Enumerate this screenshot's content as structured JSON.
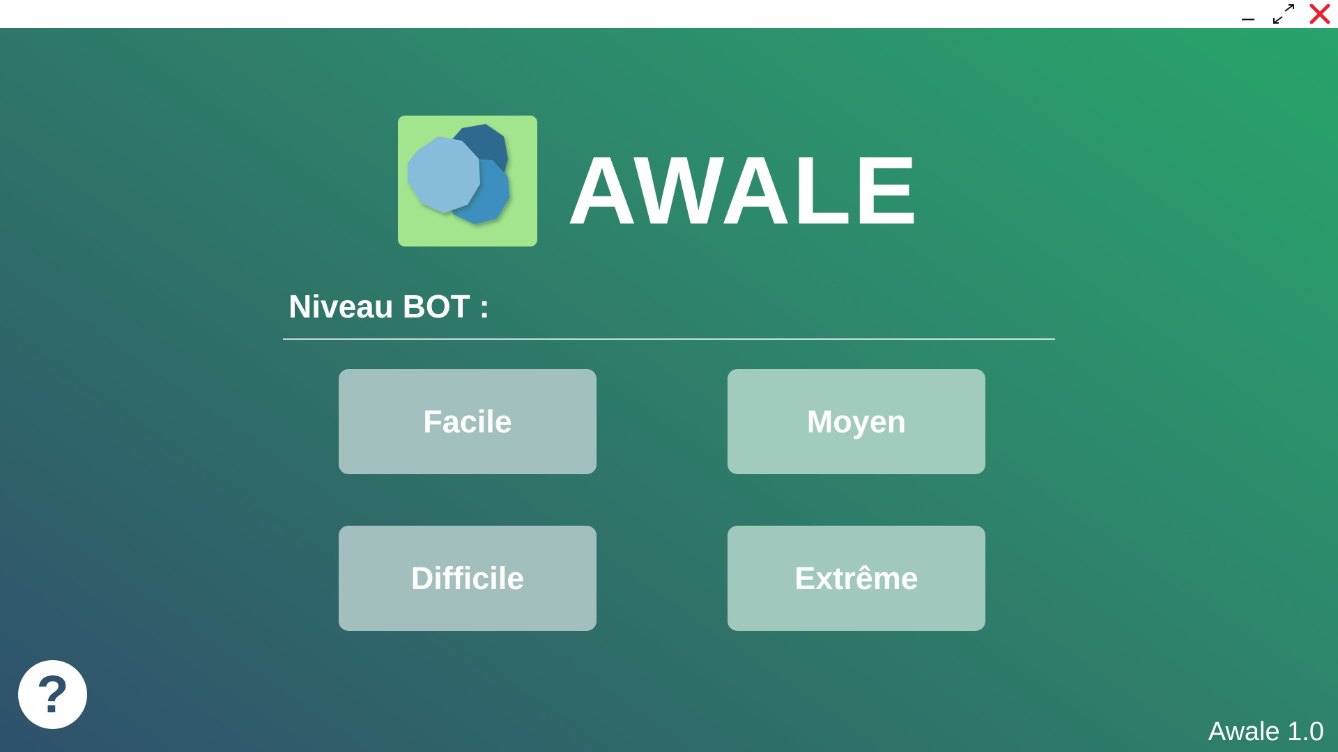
{
  "window": {
    "minimize_icon": "minimize-icon",
    "maximize_icon": "maximize-icon",
    "close_icon": "close-icon",
    "close_color": "#e8232e"
  },
  "header": {
    "logo": "awale-seeds-logo",
    "title": "AWALE"
  },
  "level_section": {
    "label": "Niveau BOT :",
    "buttons": [
      {
        "label": "Facile"
      },
      {
        "label": "Moyen"
      },
      {
        "label": "Difficile"
      },
      {
        "label": "Extrême"
      }
    ]
  },
  "footer": {
    "help_label": "?",
    "version": "Awale 1.0"
  },
  "colors": {
    "gradient_start": "#2f516c",
    "gradient_end": "#28a46a",
    "logo_bg": "#a3e48f",
    "seed_dark": "#2d6b8f",
    "seed_mid": "#3d8fbf",
    "seed_light": "#87bcdb"
  }
}
